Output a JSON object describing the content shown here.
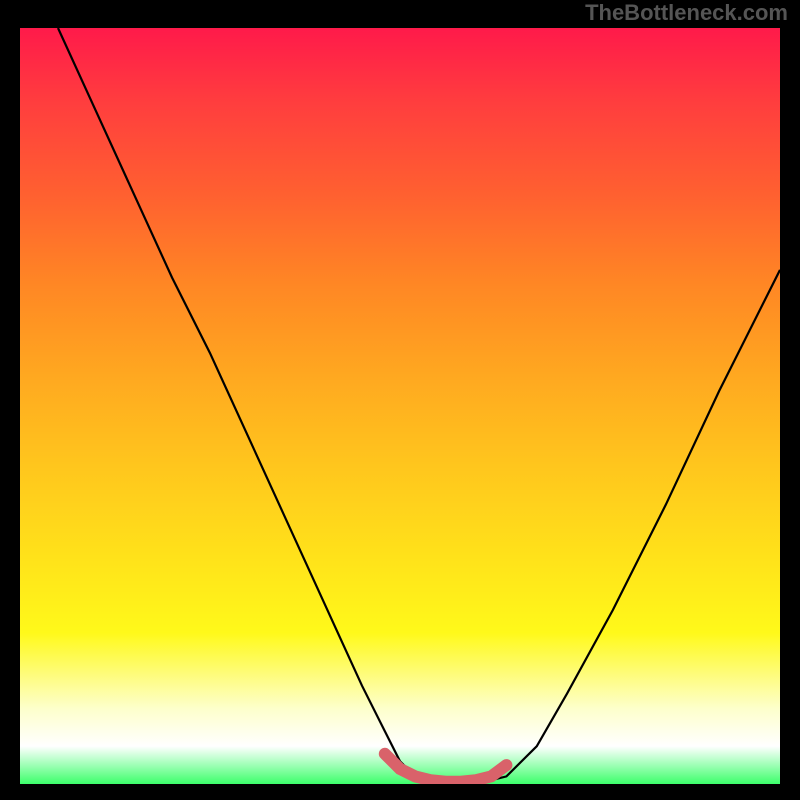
{
  "watermark": "TheBottleneck.com",
  "chart_data": {
    "type": "line",
    "title": "",
    "xlabel": "",
    "ylabel": "",
    "xlim": [
      0,
      100
    ],
    "ylim": [
      0,
      100
    ],
    "series": [
      {
        "name": "curve",
        "x": [
          5,
          10,
          15,
          20,
          25,
          30,
          35,
          40,
          45,
          48,
          50,
          52,
          55,
          58,
          60,
          62,
          64,
          68,
          72,
          78,
          85,
          92,
          100
        ],
        "y": [
          100,
          89,
          78,
          67,
          57,
          46,
          35,
          24,
          13,
          7,
          3,
          1,
          0.5,
          0.2,
          0.2,
          0.5,
          1,
          5,
          12,
          23,
          37,
          52,
          68
        ],
        "color": "#000000"
      },
      {
        "name": "trough-marker",
        "x": [
          48,
          50,
          52,
          54,
          56,
          58,
          60,
          62,
          64
        ],
        "y": [
          4,
          2,
          1,
          0.5,
          0.3,
          0.3,
          0.5,
          1,
          2.5
        ],
        "color": "#d9626a"
      }
    ]
  }
}
